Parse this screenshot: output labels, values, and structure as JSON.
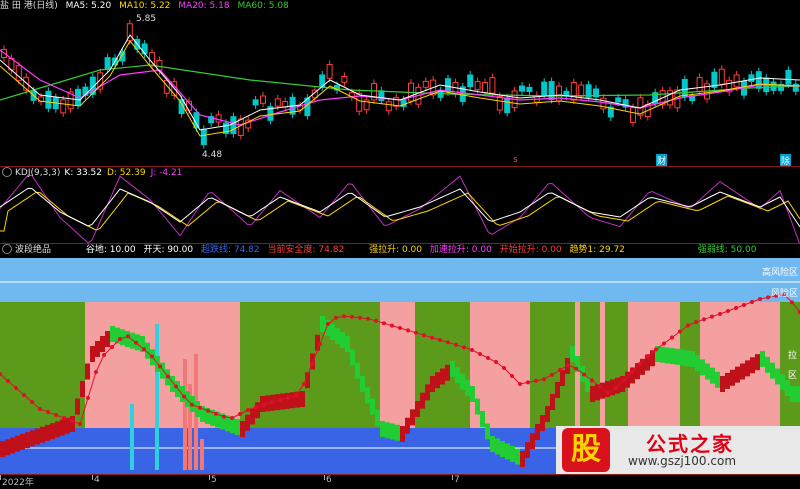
{
  "colors": {
    "up": "#ff3c3c",
    "down": "#00c8c8",
    "ma5": "#ffffff",
    "ma10": "#ffd700",
    "ma20": "#ff3cff",
    "ma60": "#33cc33",
    "k": "#ffffff",
    "d": "#ffd700",
    "j": "#c030c0",
    "green_zone": "#5c9a1c",
    "pink_zone": "#f5a0a0",
    "blue_zone": "#3a64e6",
    "light_blue": "#6fb8f0",
    "dot_line": "#e0102a"
  },
  "main": {
    "title": "盐 田 港(日线)",
    "ma5": "MA5: 5.20",
    "ma10": "MA10: 5.22",
    "ma20": "MA20: 5.18",
    "ma60": "MA60: 5.08",
    "high_label": "5.85",
    "low_label": "4.48",
    "markers": [
      "s",
      "财",
      "除"
    ]
  },
  "kdj": {
    "title": "KDJ(9,3,3)",
    "k": "K: 33.52",
    "d": "D: 52.39",
    "j": "J: -4.21"
  },
  "indicator": {
    "title": "波段绝品",
    "items": [
      "谷地: 10.00",
      "开天: 90.00",
      "超跌线: 74.82",
      "当前安全度: 74.82",
      "强拉升: 0.00",
      "加速拉升: 0.00",
      "开始拉升: 0.00",
      "趋势1: 29.72",
      "强弱线: 50.00"
    ],
    "zone_high": "高风险区",
    "zone_risk": "风险区",
    "zone_low1": "拉",
    "zone_low2": "区"
  },
  "axis": {
    "labels": [
      "2022年",
      "4",
      "5",
      "6",
      "7"
    ]
  },
  "watermark": {
    "logo": "股",
    "title": "公式之家",
    "url": "www.gszj100.com"
  }
}
